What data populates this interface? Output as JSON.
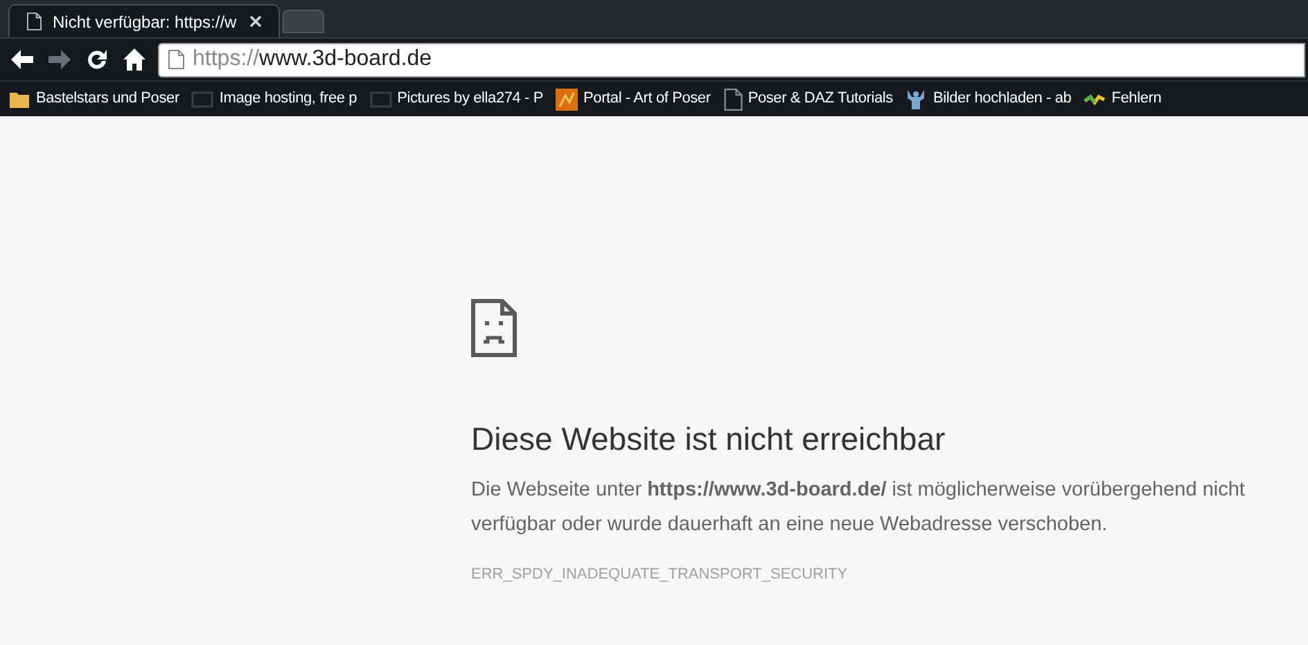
{
  "tabs": [
    {
      "title": "Nicht verfügbar: https://w",
      "selected": true
    },
    {
      "selected": false
    }
  ],
  "nav_buttons": [
    {
      "kind": "back",
      "disabled": false
    },
    {
      "kind": "forward",
      "disabled": true
    },
    {
      "kind": "reload",
      "disabled": false
    },
    {
      "kind": "home",
      "disabled": false
    }
  ],
  "address_bar": {
    "scheme": "https://",
    "host": "www.3d-board.de"
  },
  "bookmarks": [
    {
      "kind": "folder",
      "label": "Bastelstars und Poser"
    },
    {
      "kind": "photo",
      "label": "Image hosting, free p"
    },
    {
      "kind": "photo",
      "label": "Pictures by ella274 - P"
    },
    {
      "kind": "orange",
      "label": "Portal - Art of Poser"
    },
    {
      "kind": "page",
      "label": "Poser & DAZ Tutorials"
    },
    {
      "kind": "figure",
      "label": "Bilder hochladen - ab"
    },
    {
      "kind": "wave",
      "label": "Fehlern"
    }
  ],
  "error": {
    "heading": "Diese Website ist nicht erreichbar",
    "message": "Die Webseite unter **https://www.3d-board.de/** ist möglicherweise vorübergehend nicht verfügbar oder wurde dauerhaft an eine neue Webadresse verschoben.",
    "code": "ERR_SPDY_INADEQUATE_TRANSPORT_SECURITY"
  }
}
